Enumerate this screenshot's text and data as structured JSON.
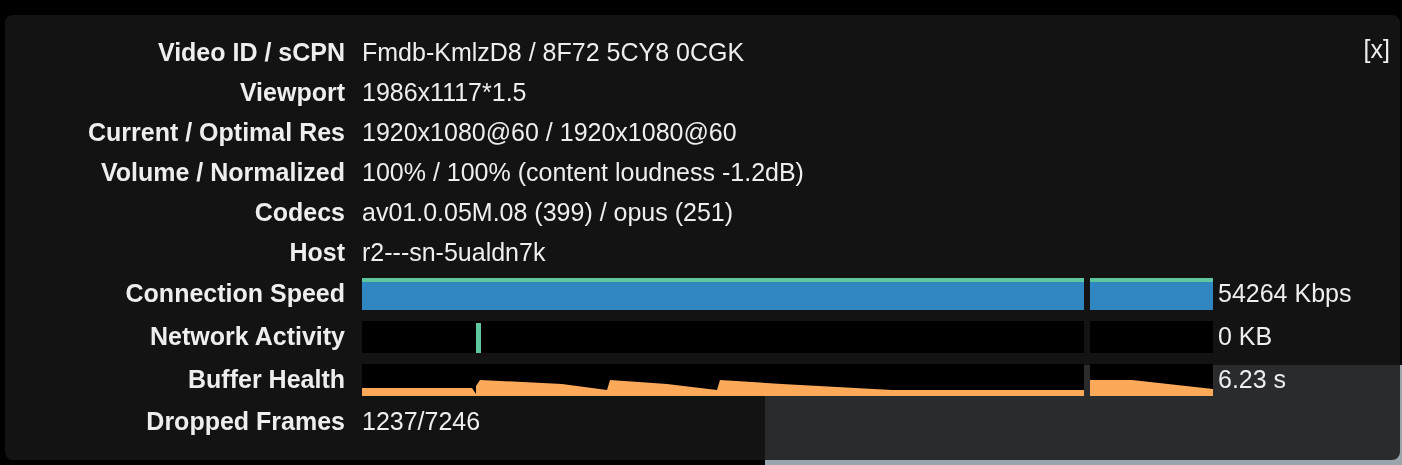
{
  "close": "[x]",
  "rows": [
    {
      "kind": "text",
      "label": "Video ID / sCPN",
      "value": "Fmdb-KmlzD8 / 8F72 5CY8 0CGK"
    },
    {
      "kind": "text",
      "label": "Viewport",
      "value": "1986x1117*1.5"
    },
    {
      "kind": "text",
      "label": "Current / Optimal Res",
      "value": "1920x1080@60 / 1920x1080@60"
    },
    {
      "kind": "text",
      "label": "Volume / Normalized",
      "value": "100% / 100% (content loudness -1.2dB)"
    },
    {
      "kind": "text",
      "label": "Codecs",
      "value": "av01.0.05M.08 (399) / opus (251)"
    },
    {
      "kind": "text",
      "label": "Host",
      "value": "r2---sn-5ualdn7k"
    },
    {
      "kind": "speed",
      "label": "Connection Speed",
      "value": "54264 Kbps"
    },
    {
      "kind": "activity",
      "label": "Network Activity",
      "value": "0 KB"
    },
    {
      "kind": "buffer",
      "label": "Buffer Health",
      "value": "6.23 s"
    },
    {
      "kind": "text",
      "label": "Dropped Frames",
      "value": "1237/7246"
    }
  ]
}
